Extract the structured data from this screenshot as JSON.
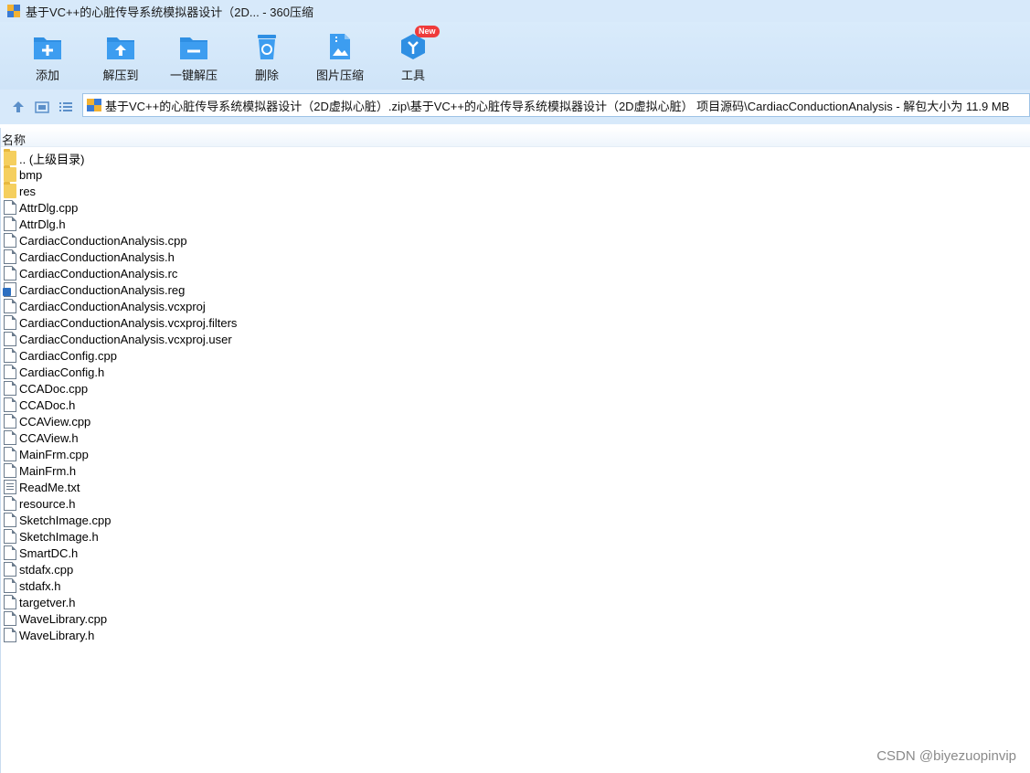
{
  "window": {
    "title": "基于VC++的心脏传导系统模拟器设计（2D... - 360压缩"
  },
  "toolbar": {
    "buttons": [
      {
        "label": "添加",
        "icon": "folder-plus-icon",
        "color": "#2f8fe3"
      },
      {
        "label": "解压到",
        "icon": "folder-extract-icon",
        "color": "#2f8fe3"
      },
      {
        "label": "一键解压",
        "icon": "folder-minus-icon",
        "color": "#2f8fe3"
      },
      {
        "label": "删除",
        "icon": "recycle-bin-icon",
        "color": "#2f8fe3"
      },
      {
        "label": "图片压缩",
        "icon": "image-compress-icon",
        "color": "#2f8fe3"
      },
      {
        "label": "工具",
        "icon": "tools-cube-icon",
        "color": "#2f8fe3",
        "badge": "New"
      }
    ]
  },
  "navbar": {
    "icons": [
      "up-arrow-icon",
      "thumbnail-view-icon",
      "list-view-icon"
    ],
    "path": "基于VC++的心脏传导系统模拟器设计（2D虚拟心脏）.zip\\基于VC++的心脏传导系统模拟器设计（2D虚拟心脏） 项目源码\\CardiacConductionAnalysis - 解包大小为 11.9 MB"
  },
  "list": {
    "header_name": "名称",
    "items": [
      {
        "name": ".. (上级目录)",
        "type": "folder"
      },
      {
        "name": "bmp",
        "type": "folder"
      },
      {
        "name": "res",
        "type": "folder"
      },
      {
        "name": "AttrDlg.cpp",
        "type": "doc"
      },
      {
        "name": "AttrDlg.h",
        "type": "doc"
      },
      {
        "name": "CardiacConductionAnalysis.cpp",
        "type": "doc"
      },
      {
        "name": "CardiacConductionAnalysis.h",
        "type": "doc"
      },
      {
        "name": "CardiacConductionAnalysis.rc",
        "type": "doc"
      },
      {
        "name": "CardiacConductionAnalysis.reg",
        "type": "reg"
      },
      {
        "name": "CardiacConductionAnalysis.vcxproj",
        "type": "doc"
      },
      {
        "name": "CardiacConductionAnalysis.vcxproj.filters",
        "type": "doc"
      },
      {
        "name": "CardiacConductionAnalysis.vcxproj.user",
        "type": "doc"
      },
      {
        "name": "CardiacConfig.cpp",
        "type": "doc"
      },
      {
        "name": "CardiacConfig.h",
        "type": "doc"
      },
      {
        "name": "CCADoc.cpp",
        "type": "doc"
      },
      {
        "name": "CCADoc.h",
        "type": "doc"
      },
      {
        "name": "CCAView.cpp",
        "type": "doc"
      },
      {
        "name": "CCAView.h",
        "type": "doc"
      },
      {
        "name": "MainFrm.cpp",
        "type": "doc"
      },
      {
        "name": "MainFrm.h",
        "type": "doc"
      },
      {
        "name": "ReadMe.txt",
        "type": "txt"
      },
      {
        "name": "resource.h",
        "type": "doc"
      },
      {
        "name": "SketchImage.cpp",
        "type": "doc"
      },
      {
        "name": "SketchImage.h",
        "type": "doc"
      },
      {
        "name": "SmartDC.h",
        "type": "doc"
      },
      {
        "name": "stdafx.cpp",
        "type": "doc"
      },
      {
        "name": "stdafx.h",
        "type": "doc"
      },
      {
        "name": "targetver.h",
        "type": "doc"
      },
      {
        "name": "WaveLibrary.cpp",
        "type": "doc"
      },
      {
        "name": "WaveLibrary.h",
        "type": "doc"
      }
    ]
  },
  "watermark": "CSDN @biyezuopinvip"
}
